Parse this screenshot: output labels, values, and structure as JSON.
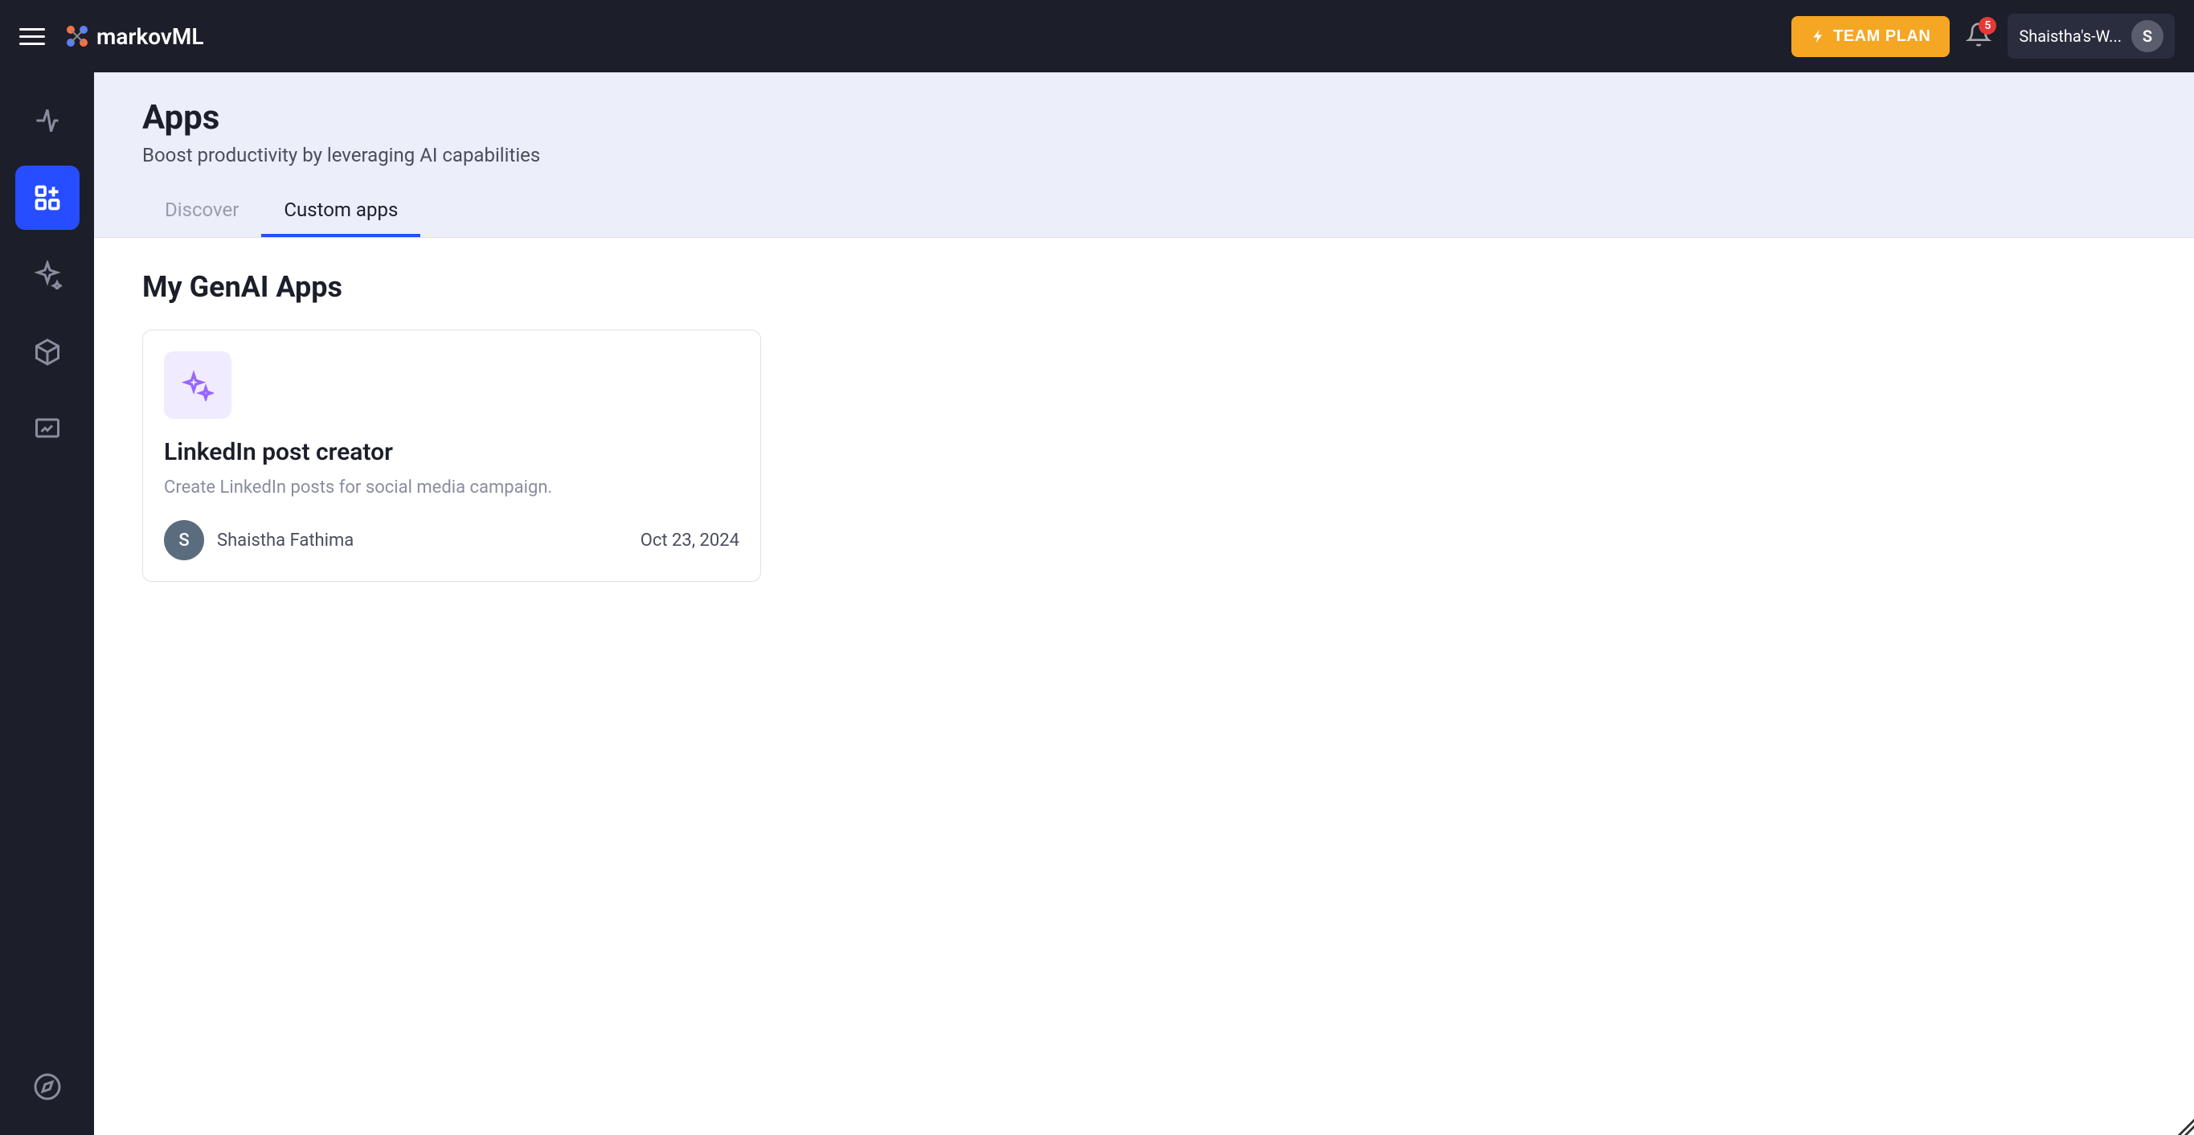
{
  "header": {
    "brand": "markovML",
    "team_plan_label": "TEAM PLAN",
    "notification_count": "5",
    "workspace_label": "Shaistha's-W...",
    "workspace_initial": "S"
  },
  "page": {
    "title": "Apps",
    "subtitle": "Boost productivity by leveraging AI capabilities"
  },
  "tabs": {
    "discover": "Discover",
    "custom_apps": "Custom apps"
  },
  "section": {
    "title": "My GenAI Apps"
  },
  "apps": [
    {
      "title": "LinkedIn post creator",
      "description": "Create LinkedIn posts for social media campaign.",
      "author_name": "Shaistha Fathima",
      "author_initial": "S",
      "date": "Oct 23, 2024"
    }
  ]
}
